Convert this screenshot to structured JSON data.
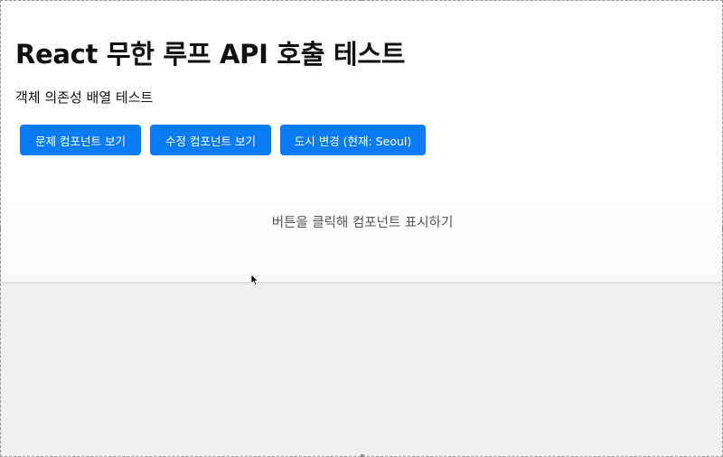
{
  "page": {
    "title": "React 무한 루프 API 호출 테스트",
    "subtitle": "객체 의존성 배열 테스트",
    "placeholder": "버튼을 클릭해 컴포넌트 표시하기"
  },
  "buttons": {
    "problem_label": "문제 컴포넌트 보기",
    "fixed_label": "수정 컴포넌트 보기",
    "city_label": "도시 변경 (현재: Seoul)"
  },
  "colors": {
    "button_bg": "#0a7cf5",
    "button_text": "#ffffff",
    "panel_bg": "#ffffff",
    "backdrop": "#efefef"
  },
  "icons": {
    "cursor": "mouse-pointer-icon"
  }
}
